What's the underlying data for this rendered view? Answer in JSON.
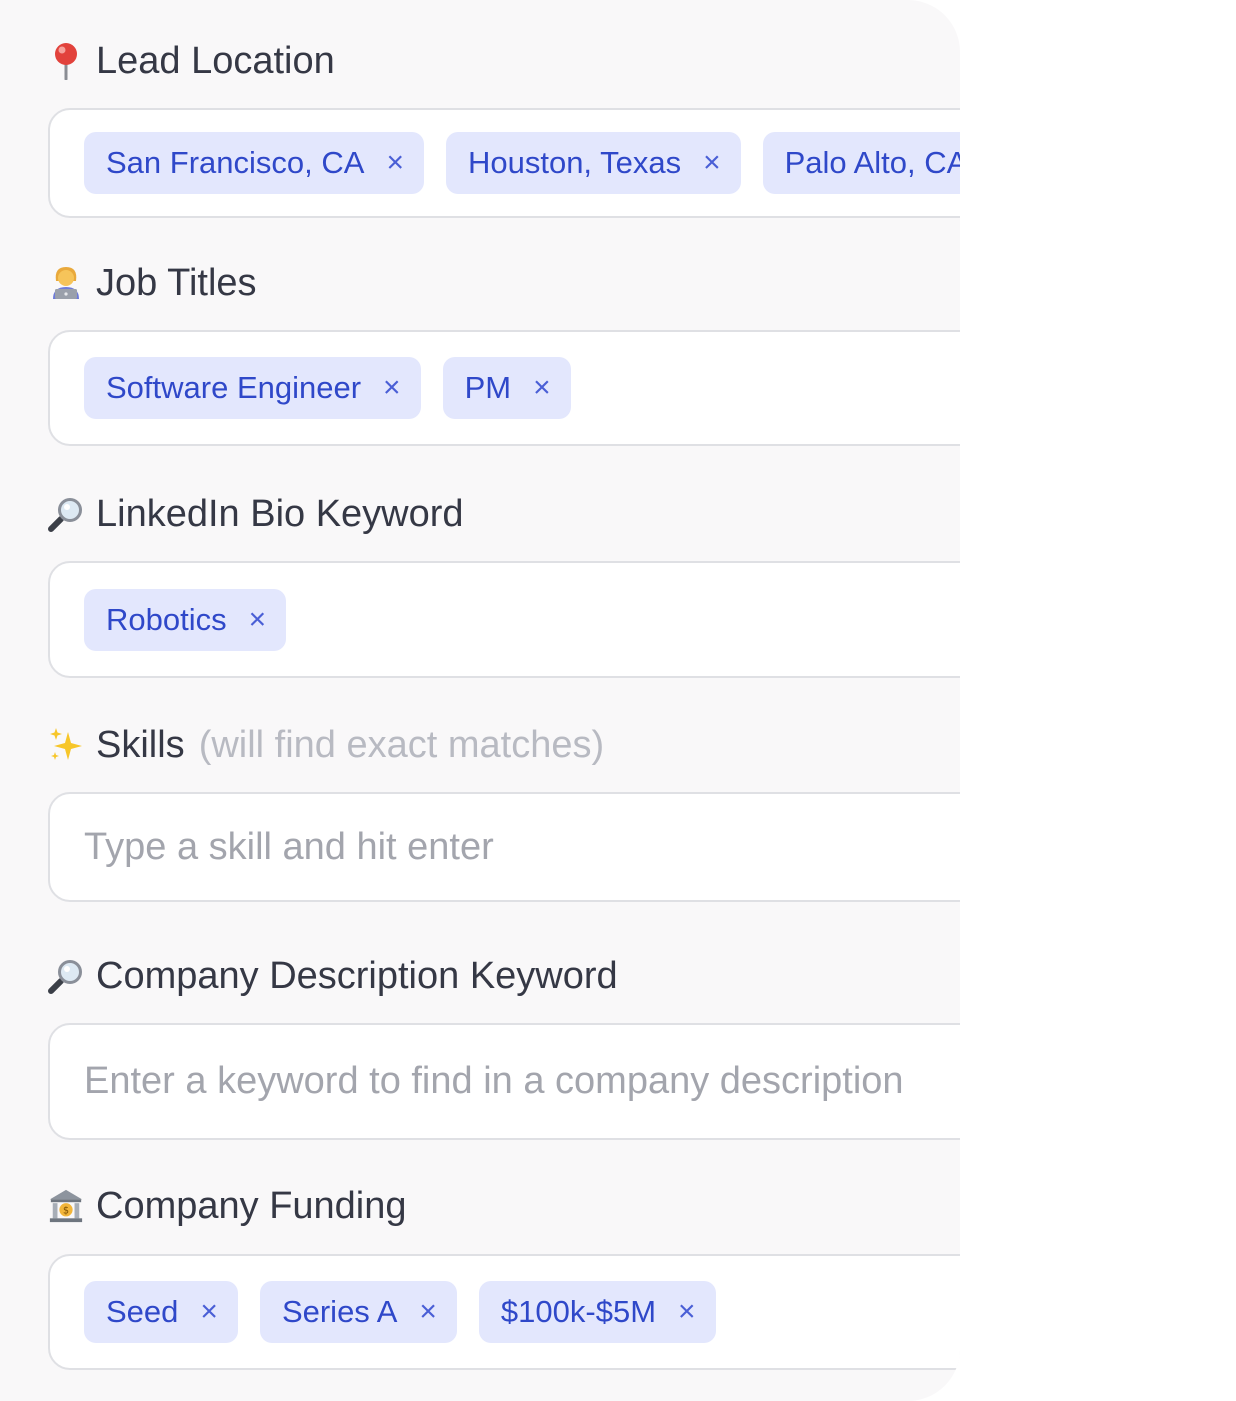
{
  "sections": [
    {
      "label": "Lead Location",
      "icon": "pin-icon",
      "tags": [
        "San Francisco, CA",
        "Houston, Texas",
        "Palo Alto, CA"
      ]
    },
    {
      "label": "Job Titles",
      "icon": "technologist-icon",
      "tags": [
        "Software Engineer",
        "PM"
      ]
    },
    {
      "label": "LinkedIn Bio Keyword",
      "icon": "magnifier-icon",
      "tags": [
        "Robotics"
      ]
    },
    {
      "label": "Skills",
      "hint": "(will find exact matches)",
      "icon": "sparkles-icon",
      "placeholder": "Type a skill and hit enter"
    },
    {
      "label": "Company Description Keyword",
      "icon": "magnifier-icon",
      "placeholder": "Enter a keyword to find in a company description"
    },
    {
      "label": "Company Funding",
      "icon": "bank-icon",
      "tags": [
        "Seed",
        "Series A",
        "$100k-$5M"
      ]
    }
  ],
  "tag_remove_glyph": "×",
  "colors": {
    "panel_bg": "#f9f8f9",
    "tag_bg": "#e3e7fd",
    "tag_text": "#2f48c9",
    "label_text": "#353845",
    "placeholder_text": "#a3a5ad",
    "field_border": "#dfe0e4"
  }
}
